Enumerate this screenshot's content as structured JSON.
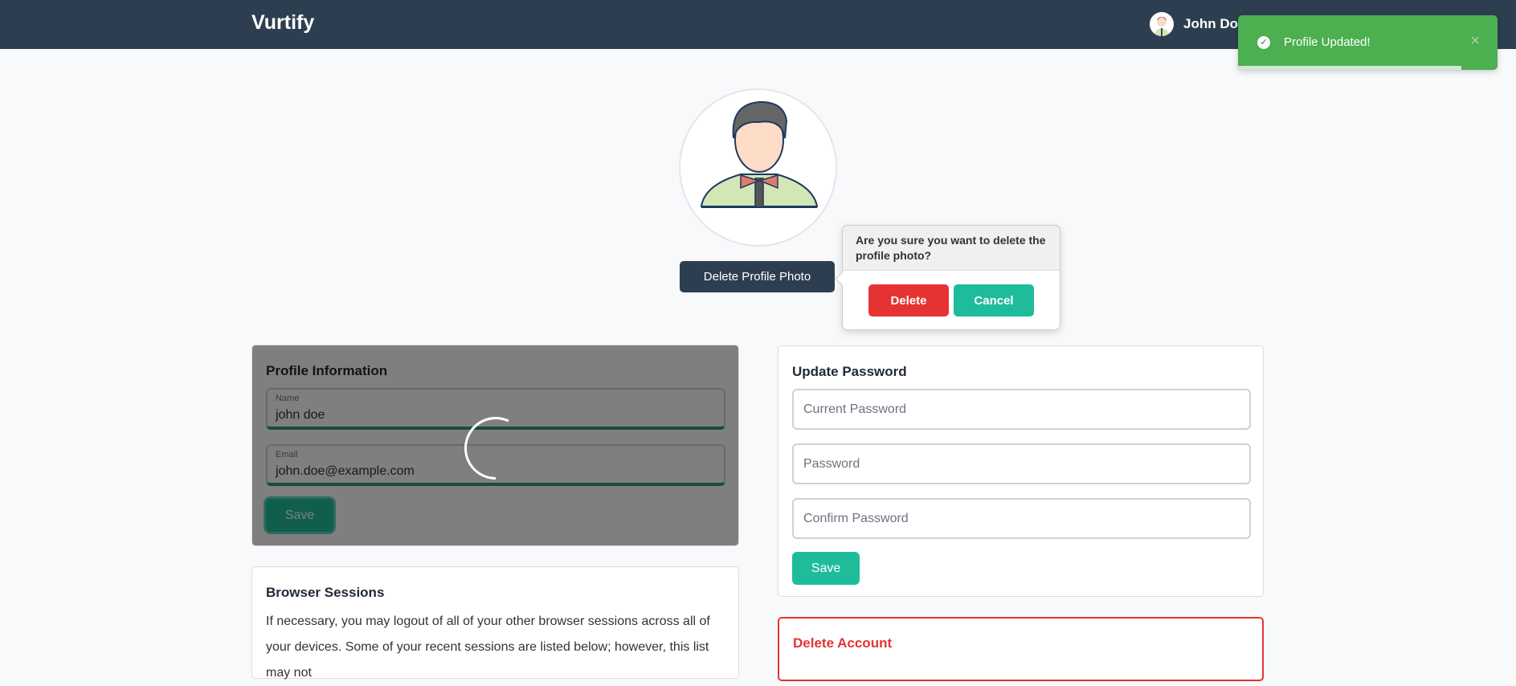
{
  "header": {
    "logo": "Vurtify",
    "user_name": "John Do"
  },
  "toast": {
    "message": "Profile Updated!",
    "close": "×",
    "icon": "check-circle-icon",
    "progress_percent": 86,
    "color": "#4caf50"
  },
  "profile_photo": {
    "delete_button": "Delete Profile Photo"
  },
  "confirm_popover": {
    "question": "Are you sure you want to delete the profile photo?",
    "delete_label": "Delete",
    "cancel_label": "Cancel"
  },
  "profile_info": {
    "title": "Profile Information",
    "name_label": "Name",
    "name_value": "john doe",
    "email_label": "Email",
    "email_value": "john.doe@example.com",
    "save_label": "Save",
    "loading": true
  },
  "update_password": {
    "title": "Update Password",
    "current_placeholder": "Current Password",
    "password_placeholder": "Password",
    "confirm_placeholder": "Confirm Password",
    "save_label": "Save"
  },
  "browser_sessions": {
    "title": "Browser Sessions",
    "description": "If necessary, you may logout of all of your other browser sessions across all of your devices. Some of your recent sessions are listed below; however, this list may not"
  },
  "delete_account": {
    "title": "Delete Account"
  },
  "colors": {
    "header": "#2d3e50",
    "accent": "#1fbc9c",
    "danger": "#e53333"
  }
}
